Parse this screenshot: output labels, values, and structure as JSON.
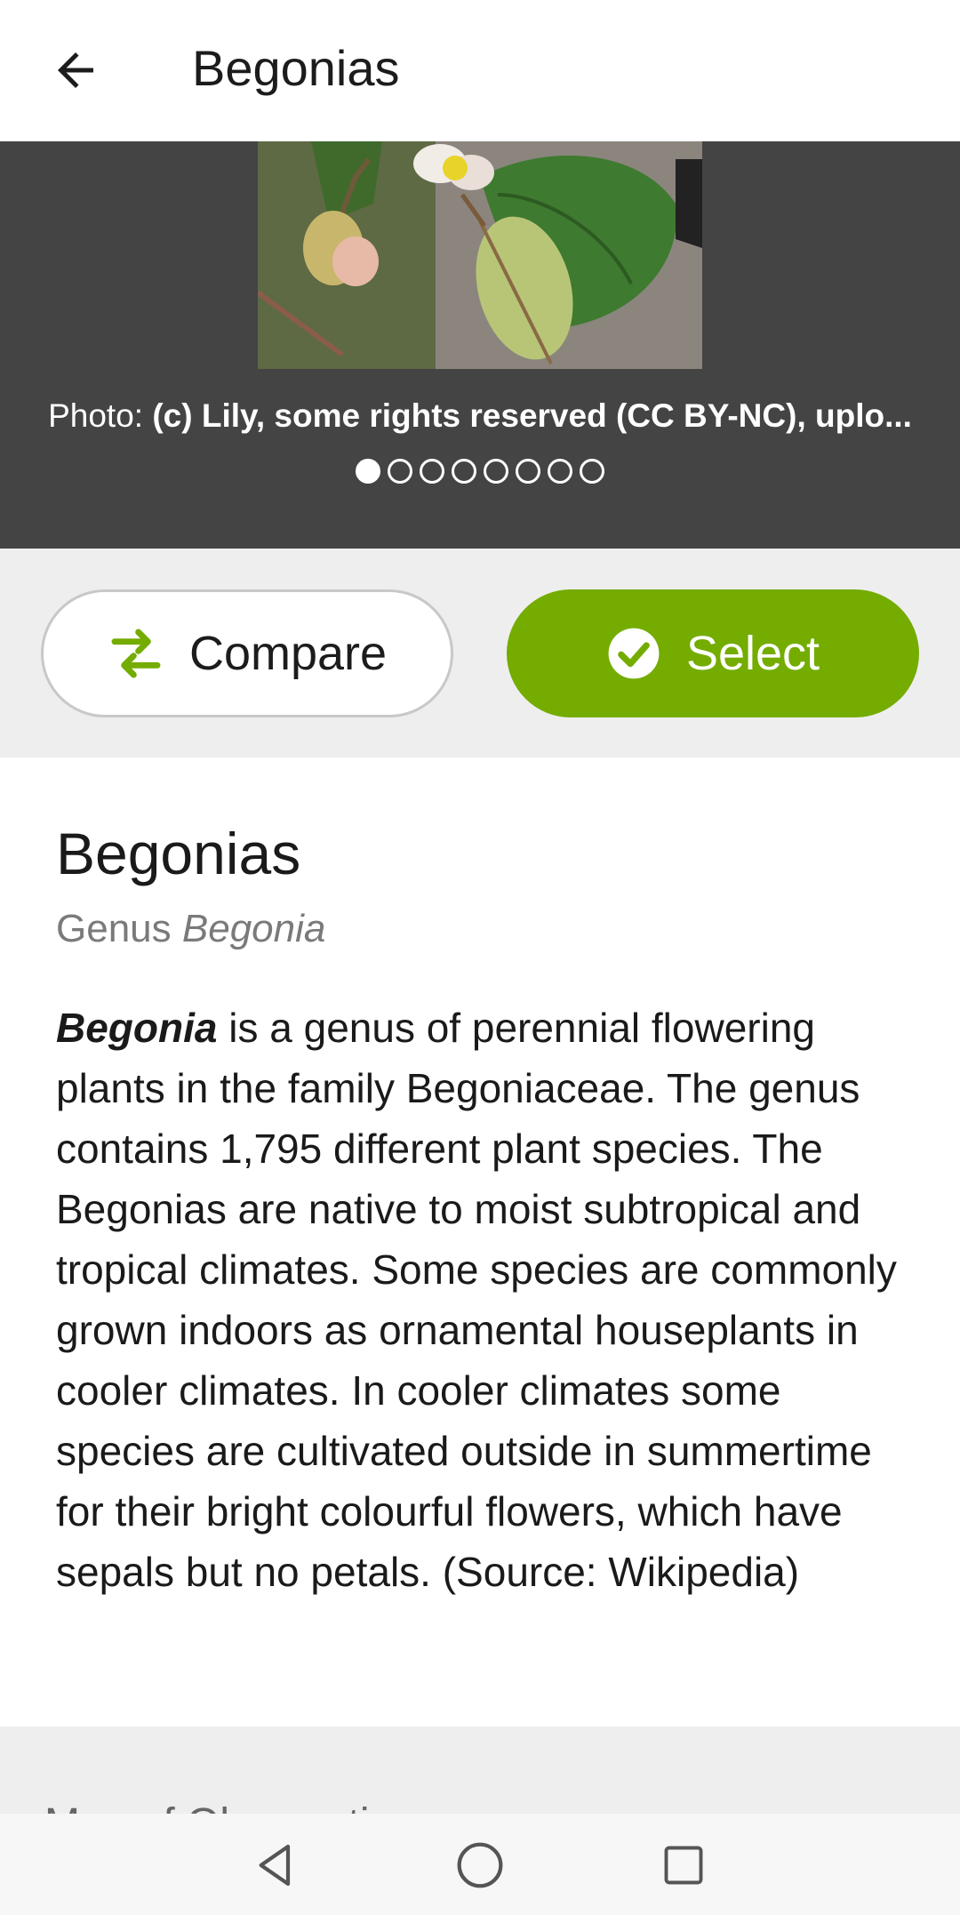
{
  "appbar": {
    "title": "Begonias"
  },
  "photo": {
    "caption_prefix": "Photo: ",
    "caption_credit": "(c) Lily, some rights reserved (CC BY-NC), uplo...",
    "dots_total": 8,
    "dots_active": 1
  },
  "actions": {
    "compare_label": "Compare",
    "select_label": "Select"
  },
  "taxon": {
    "name": "Begonias",
    "rank": "Genus",
    "scientific_name": "Begonia",
    "description_lead": "Begonia",
    "description_rest": " is a genus of perennial flowering plants in the family Begoniaceae. The genus contains 1,795 different plant species. The Begonias are native to moist subtropical and tropical climates. Some species are commonly grown indoors as ornamental houseplants in cooler climates. In cooler climates some species are cultivated outside in summertime for their bright colourful flowers, which have sepals but no petals. (Source: Wikipedia)"
  },
  "next_section": {
    "title": "Map of Observations"
  },
  "colors": {
    "accent": "#74ac00",
    "photo_bg": "#444444",
    "band_bg": "#eeeeee"
  },
  "icons": [
    "back-arrow-icon",
    "compare-arrows-icon",
    "check-circle-icon",
    "nav-back-icon",
    "nav-home-icon",
    "nav-recents-icon"
  ]
}
